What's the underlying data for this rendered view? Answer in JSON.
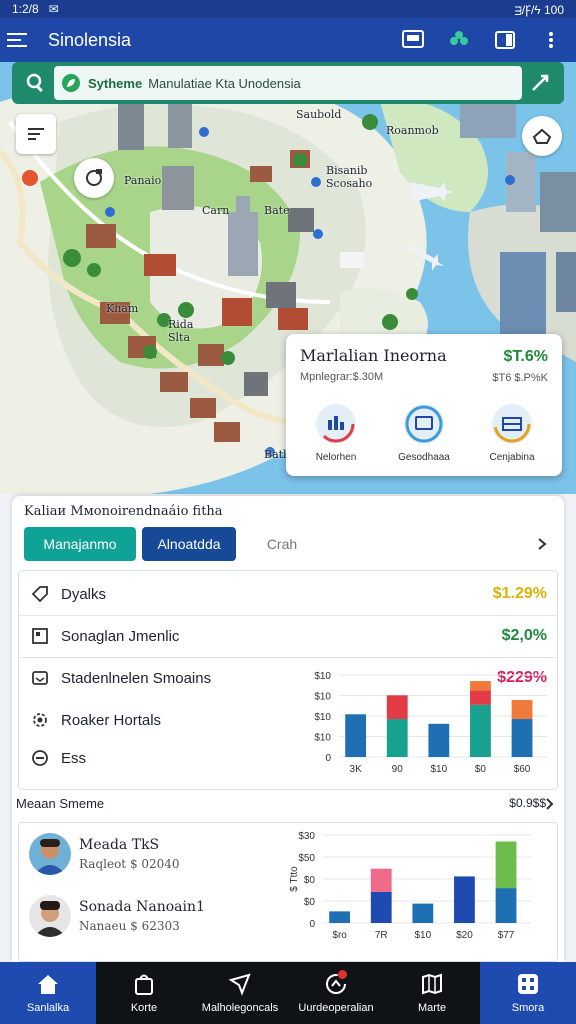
{
  "status": {
    "time": "1:2/8",
    "right": "ᴟ/Ꝼ/ϟ 100"
  },
  "appbar": {
    "title": "Sinolensia"
  },
  "search": {
    "lead": "Sytheme",
    "value": "Manulatiae Kta Unodensia"
  },
  "map": {
    "labels": [
      "Saubold",
      "Roanmob",
      "Panaio",
      "Bisanib Scosaho",
      "Carn",
      "Bate",
      "Kham",
      "Rida Slta",
      "Batlo"
    ]
  },
  "info_card": {
    "title": "Marlalian Ineorna",
    "value": "$T.6%",
    "subtitle": "Mpnlegrar:$.30M",
    "subvalue": "$T6 $.P%K",
    "items": [
      {
        "label": "Nelorhen",
        "icon": "chart-ring-icon"
      },
      {
        "label": "Gesodhaaa",
        "icon": "monitor-ring-icon"
      },
      {
        "label": "Cenjabina",
        "icon": "table-ring-icon"
      }
    ]
  },
  "panel": {
    "heading": "Kaliaи Mмonoirendnaáio fitha",
    "tabs": [
      "Manajanmo",
      "Alnoatdda",
      "Crah"
    ],
    "rows": [
      {
        "label": "Dyalks",
        "value": "$1.29%",
        "color": "#d7b30a"
      },
      {
        "label": "Sonaglan Jmenlic",
        "value": "$2,0%",
        "color": "#1f8a3c"
      },
      {
        "label": "Stadenlnelen Smoains",
        "value": "$229%",
        "color": "#d81f5e"
      },
      {
        "label": "Roaker Hortals",
        "value": "",
        "color": "#1d2430"
      },
      {
        "label": "Ess",
        "value": "",
        "color": "#1d2430"
      }
    ]
  },
  "chart_top": {
    "y_ticks": [
      "$10",
      "$10",
      "$10",
      "$10",
      "0"
    ],
    "x_ticks": [
      "3K",
      "90",
      "$10",
      "$0",
      "$60"
    ]
  },
  "section2": {
    "title": "Meaan Smeme",
    "right": "$0.9$$"
  },
  "people": [
    {
      "name": "Meada TkS",
      "sub": "Raqleot $ 02040"
    },
    {
      "name": "Sonada Nanoain1",
      "sub": "Nanaeu $ 62303"
    }
  ],
  "chart_bottom": {
    "y_ticks": [
      "$30",
      "$50",
      "$0",
      "$0",
      "0"
    ],
    "y_label": "$ Ttto",
    "x_ticks": [
      "$ro",
      "7R",
      "$10",
      "$20",
      "$77"
    ]
  },
  "chart_data": [
    {
      "type": "bar",
      "categories": [
        "3K",
        "90",
        "$10",
        "$0",
        "$60"
      ],
      "series": [
        {
          "values": [
            9,
            8,
            7,
            11,
            8
          ]
        },
        {
          "values": [
            0,
            5,
            0,
            3,
            0
          ]
        },
        {
          "values": [
            0,
            0,
            0,
            2,
            4
          ]
        }
      ]
    },
    {
      "type": "bar",
      "categories": [
        "$ro",
        "7R",
        "$10",
        "$20",
        "$77"
      ],
      "series": [
        {
          "values": [
            3,
            8,
            5,
            12,
            9
          ]
        },
        {
          "values": [
            0,
            6,
            0,
            0,
            0
          ]
        },
        {
          "values": [
            0,
            0,
            0,
            0,
            12
          ]
        }
      ]
    }
  ],
  "bottom_nav": [
    {
      "label": "Sanlalka",
      "icon": "home-icon",
      "active": true
    },
    {
      "label": "Korte",
      "icon": "bag-icon",
      "active": false
    },
    {
      "label": "Malholegoncals",
      "icon": "navigate-icon",
      "active": false
    },
    {
      "label": "Uurdeoperalian",
      "icon": "refresh-icon",
      "active": false
    },
    {
      "label": "Marte",
      "icon": "map-icon",
      "active": false
    },
    {
      "label": "Smora",
      "icon": "grid-icon",
      "active": true
    }
  ]
}
